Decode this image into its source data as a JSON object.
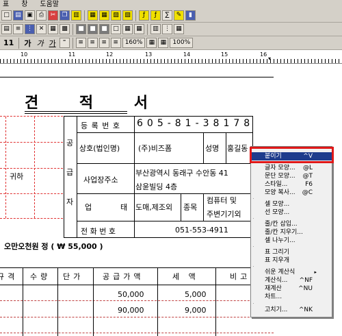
{
  "menu": {
    "items": [
      "표",
      "창",
      "도움말"
    ]
  },
  "toolbar3": {
    "char1": "가",
    "char2": "가",
    "char3": "가",
    "zoom1": "160%",
    "zoom2": "100%"
  },
  "ruler": {
    "labels": [
      "10",
      "11",
      "12",
      "13",
      "14",
      "15",
      "16"
    ]
  },
  "doc": {
    "title": "견 적 서",
    "to_label": "귀하",
    "side_labels": [
      "공",
      "급",
      "자"
    ],
    "reg_label": "등 록 번 호",
    "reg_number": "605-81-38178",
    "company_label": "상호(법인명)",
    "company_name": "(주)비즈폼",
    "name_label": "성명",
    "name_value": "홍길동",
    "address_label": "사업장주소",
    "address_line1": "부산광역시 동래구 수안동 41",
    "address_line2": "삼윤빌딩 4층",
    "type_label1": "업",
    "type_label2": "태",
    "type_value": "도매,제조외",
    "item_label": "종목",
    "item_value1": "컴퓨터 및",
    "item_value2": "주변기기외",
    "phone_label": "전 화 번 호",
    "phone_value": "051-553-4911",
    "amount_text": "오만오천원 정 ( ₩ 55,000 )",
    "headers": [
      "규격",
      "수량",
      "단가",
      "공급가액",
      "세 액",
      "비고"
    ],
    "rows": [
      {
        "supply": "50,000",
        "tax": "5,000"
      },
      {
        "supply": "90,000",
        "tax": "9,000"
      }
    ]
  },
  "context_menu": {
    "items": [
      {
        "label": "붙이기",
        "key": "^V",
        "selected": true
      },
      {
        "label": "글자 모양...",
        "key": "@L"
      },
      {
        "label": "문단 모양...",
        "key": "@T"
      },
      {
        "label": "스타일...",
        "key": "F6"
      },
      {
        "label": "모양 복사...",
        "key": "@C"
      },
      {
        "label": "셀 모양..."
      },
      {
        "label": "선 모양..."
      },
      {
        "label": "줄/칸 삽입..."
      },
      {
        "label": "줄/칸 지우기..."
      },
      {
        "label": "셀 나누기..."
      },
      {
        "label": "표 그리기"
      },
      {
        "label": "표 지우개"
      },
      {
        "label": "쉬운 계산식",
        "submenu": true
      },
      {
        "label": "계산식...",
        "key": "^NF"
      },
      {
        "label": "재계산",
        "key": "^NU"
      },
      {
        "label": "차트..."
      },
      {
        "label": "고치기...",
        "key": "^NK"
      }
    ]
  }
}
